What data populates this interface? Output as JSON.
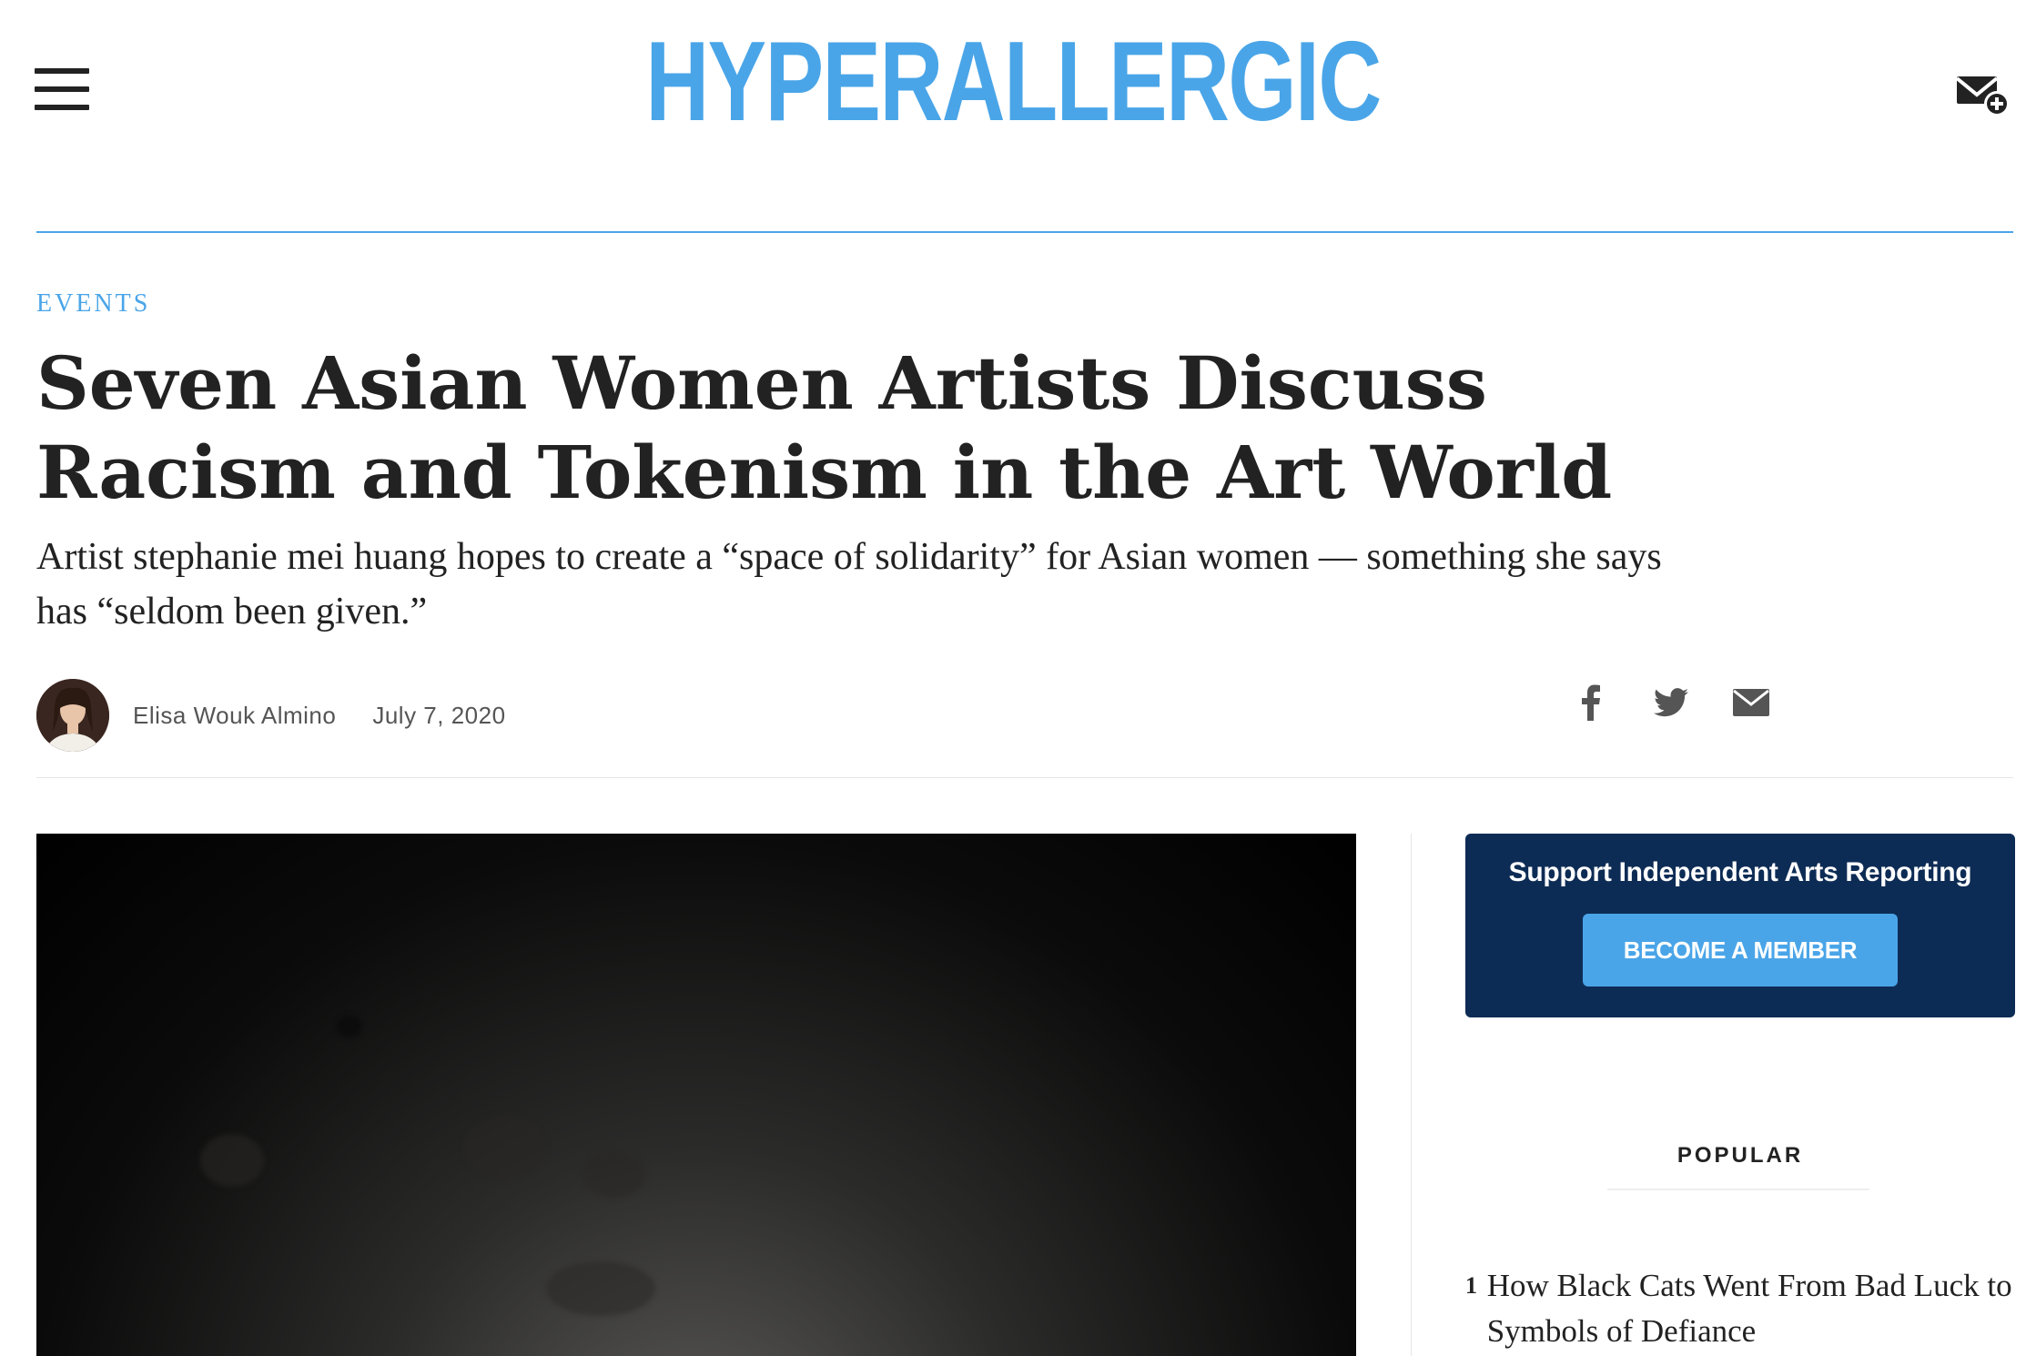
{
  "site": {
    "logo": "HYPERALLERGIC"
  },
  "article": {
    "category": "EVENTS",
    "headline": "Seven Asian Women Artists Discuss Racism and Tokenism in the Art World",
    "dek": "Artist stephanie mei huang hopes to create a “space of solidarity” for Asian women — something she says has “seldom been given.”",
    "author": "Elisa Wouk Almino",
    "date": "July 7, 2020"
  },
  "icons": {
    "menu": "hamburger-menu-icon",
    "newsletter": "mail-plus-icon",
    "share": [
      "facebook-icon",
      "twitter-icon",
      "email-icon"
    ]
  },
  "sidebar": {
    "support_title": "Support Independent Arts Reporting",
    "member_button": "BECOME A MEMBER",
    "popular_label": "POPULAR",
    "popular": [
      {
        "rank": "1",
        "title": "How Black Cats Went From Bad Luck to Symbols of Defiance"
      }
    ]
  },
  "colors": {
    "brand_blue": "#4aa5e8",
    "navy": "#0d2c55",
    "text": "#222222"
  }
}
